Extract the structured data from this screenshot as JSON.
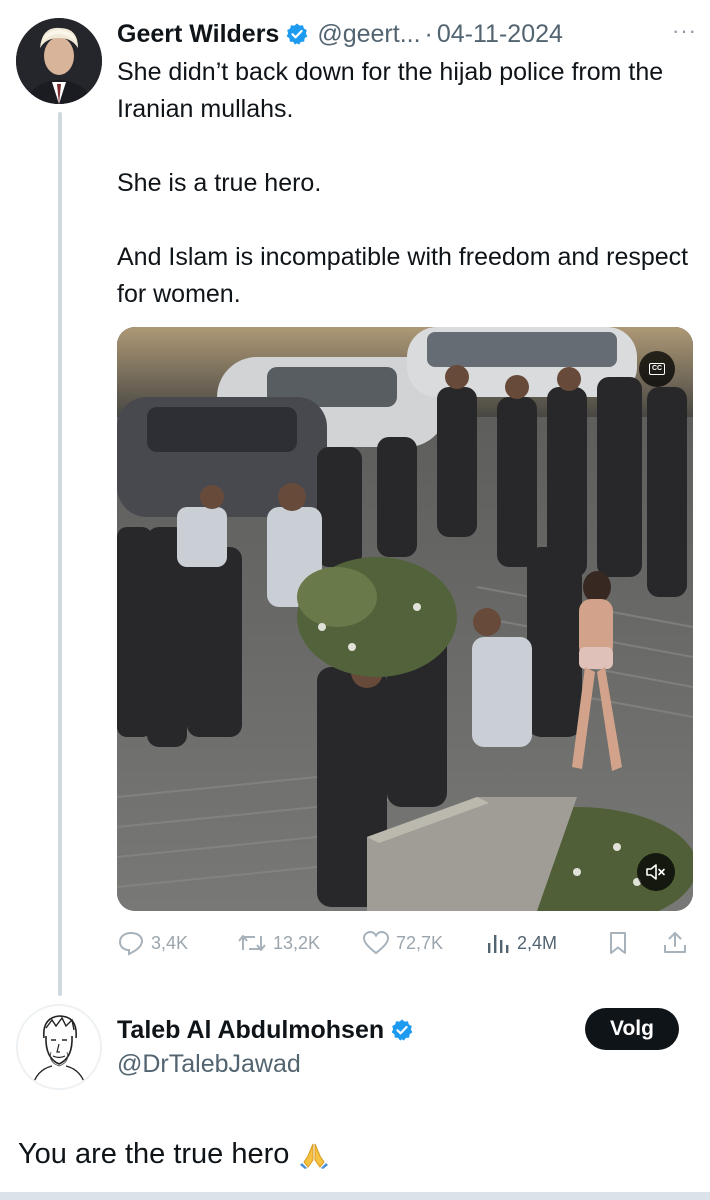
{
  "tweet": {
    "author_name": "Geert Wilders",
    "handle": "@geert...",
    "separator": "·",
    "date": "04-11-2024",
    "more_label": "···",
    "paragraphs": [
      "She didn’t back down for the hijab police from the Iranian mullahs.",
      "She is a true hero.",
      "And Islam is incompatible with freedom and respect for women."
    ],
    "media": {
      "cc_label": "CC",
      "icons": [
        "closed-captions-icon",
        "mute-icon"
      ]
    },
    "stats": {
      "replies": "3,4K",
      "reposts": "13,2K",
      "likes": "72,7K",
      "views": "2,4M"
    },
    "icons": [
      "reply-icon",
      "repost-icon",
      "like-icon",
      "views-icon",
      "bookmark-icon",
      "share-icon",
      "verified-badge-icon"
    ]
  },
  "reply": {
    "author_name": "Taleb Al Abdulmohsen",
    "handle": "@DrTalebJawad",
    "follow_label": "Volg",
    "text": "You are the true hero",
    "emoji_icon": "folded-hands-icon"
  },
  "colors": {
    "text": "#0f1419",
    "secondary": "#536471",
    "verified": "#1d9bf0",
    "follow_bg": "#0f1419",
    "thread_line": "#cfd9de"
  }
}
